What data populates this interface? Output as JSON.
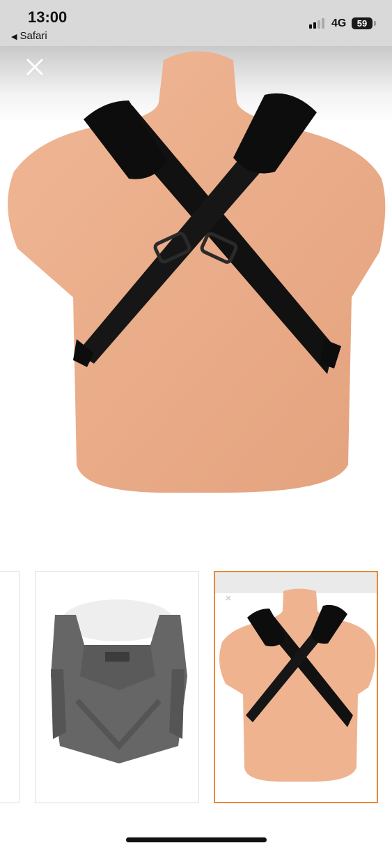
{
  "status_bar": {
    "time": "13:00",
    "back_app": "Safari",
    "back_arrow_icon": "back-triangle-icon",
    "network": "4G",
    "battery": "59"
  },
  "viewer": {
    "close_icon": "close-icon",
    "main_image": "harness-back-view",
    "thumbnails": [
      {
        "name": "previous-thumbnail",
        "selected": false
      },
      {
        "name": "baby-carrier-thumbnail",
        "selected": false
      },
      {
        "name": "harness-back-thumbnail",
        "selected": true
      }
    ],
    "selected_border_color": "#e88a3a"
  }
}
